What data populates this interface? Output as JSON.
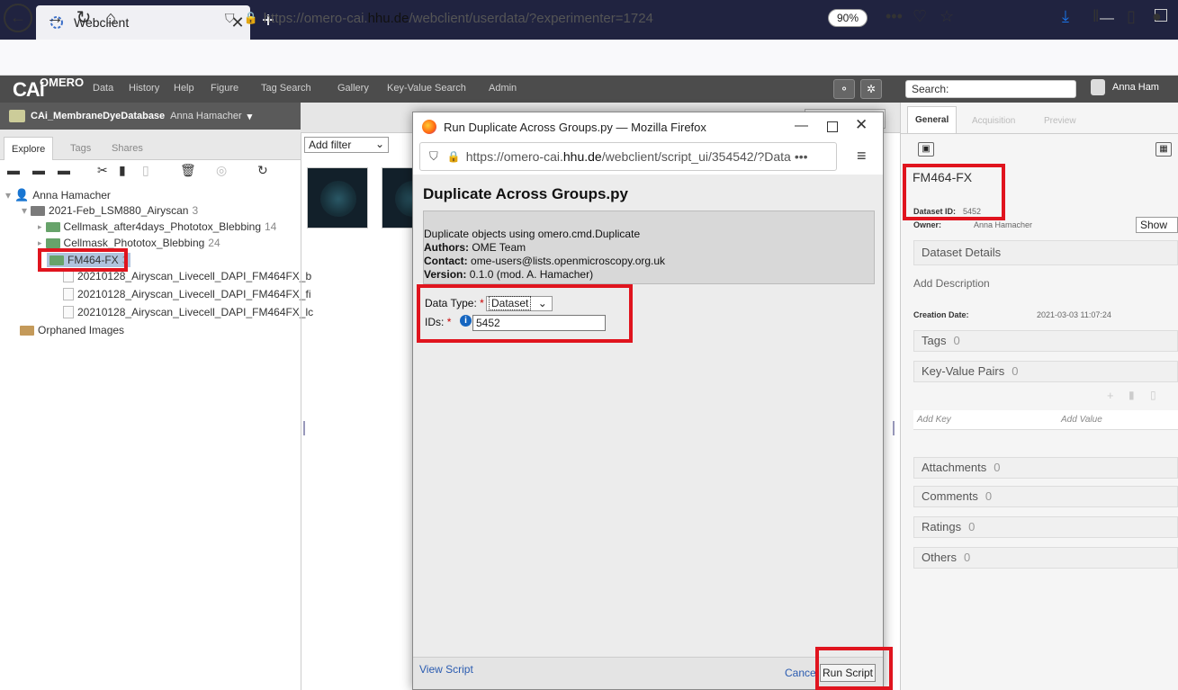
{
  "browser": {
    "tab_title": "Webclient",
    "url_prefix": "https://omero-cai.",
    "url_domain": "hhu.de",
    "url_path": "/webclient/userdata/?experimenter=1724",
    "zoom": "90%"
  },
  "omero": {
    "brand": "CAi",
    "logo": "OMERO",
    "menu": [
      "Data",
      "History",
      "Help",
      "Figure",
      "Tag Search",
      "Gallery",
      "Key-Value Search",
      "Admin"
    ],
    "search_placeholder": "Search:",
    "user": "Anna Ham"
  },
  "left": {
    "group": "CAi_MembraneDyeDatabase",
    "group_user": "Anna Hamacher",
    "tabs": [
      "Explore",
      "Tags",
      "Shares"
    ],
    "tree": {
      "root": "Anna Hamacher",
      "project": "2021-Feb_LSM880_Airyscan",
      "project_count": "3",
      "datasets": [
        {
          "name": "Cellmask_after4days_Phototox_Blebbing",
          "count": "14"
        },
        {
          "name": "Cellmask_Phototox_Blebbing",
          "count": "24"
        },
        {
          "name": "FM464-FX",
          "count": "3"
        }
      ],
      "images": [
        "20210128_Airyscan_Livecell_DAPI_FM464FX_b",
        "20210128_Airyscan_Livecell_DAPI_FM464FX_fi",
        "20210128_Airyscan_Livecell_DAPI_FM464FX_lc"
      ],
      "orphaned": "Orphaned Images"
    }
  },
  "center": {
    "filter_label": "Add filter"
  },
  "right": {
    "tabs": [
      "General",
      "Acquisition",
      "Preview"
    ],
    "name": "FM464-FX",
    "dataset_id_label": "Dataset ID:",
    "dataset_id": "5452",
    "owner_label": "Owner:",
    "owner": "Anna Hamacher",
    "show_button": "Show",
    "dataset_details": "Dataset Details",
    "add_description": "Add Description",
    "creation_label": "Creation Date:",
    "creation_date": "2021-03-03 11:07:24",
    "sections": [
      {
        "label": "Tags",
        "count": "0"
      },
      {
        "label": "Key-Value Pairs",
        "count": "0"
      }
    ],
    "add_key": "Add Key",
    "add_value": "Add Value",
    "sections2": [
      {
        "label": "Attachments",
        "count": "0"
      },
      {
        "label": "Comments",
        "count": "0"
      },
      {
        "label": "Ratings",
        "count": "0"
      },
      {
        "label": "Others",
        "count": "0"
      }
    ]
  },
  "popup": {
    "window_title": "Run Duplicate Across Groups.py — Mozilla Firefox",
    "url_prefix": "https://omero-cai.",
    "url_domain": "hhu.de",
    "url_path": "/webclient/script_ui/354542/?Data",
    "heading": "Duplicate Across Groups.py",
    "description": "Duplicate objects using omero.cmd.Duplicate",
    "authors_label": "Authors:",
    "authors": "OME Team",
    "contact_label": "Contact:",
    "contact": "ome-users@lists.openmicroscopy.org.uk",
    "version_label": "Version:",
    "version": "0.1.0 (mod. A. Hamacher)",
    "data_type_label": "Data Type:",
    "data_type_value": "Dataset",
    "ids_label": "IDs:",
    "ids_value": "5452",
    "view_script": "View Script",
    "cancel": "Cance",
    "run_script": "Run Script"
  }
}
